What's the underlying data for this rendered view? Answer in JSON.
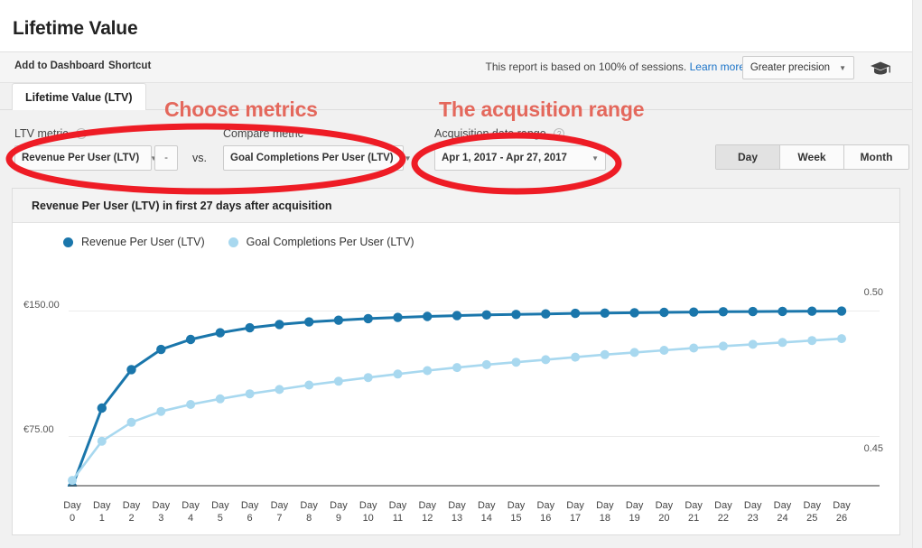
{
  "header": {
    "title": "Lifetime Value",
    "actions": [
      {
        "label": "Add to Dashboard"
      },
      {
        "label": "Shortcut"
      }
    ],
    "sampling_text": "This report is based on 100% of sessions.",
    "sampling_link": "Learn more",
    "precision_value": "Greater precision",
    "gradcap_icon": "graduation-cap-icon"
  },
  "tabs": [
    {
      "label": "Lifetime Value (LTV)",
      "active": true
    }
  ],
  "controls": {
    "ltv_metric_label": "LTV metric",
    "ltv_metric_value": "Revenue Per User (LTV)",
    "dash_value": "-",
    "vs_label": "vs.",
    "compare_metric_label": "Compare metric",
    "compare_metric_value": "Goal Completions Per User (LTV)",
    "acquisition_label": "Acquisition date range",
    "acquisition_value": "Apr 1, 2017  -  Apr 27, 2017",
    "granularity": [
      {
        "label": "Day",
        "active": true
      },
      {
        "label": "Week",
        "active": false
      },
      {
        "label": "Month",
        "active": false
      }
    ]
  },
  "annotations": [
    {
      "text": "Choose metrics"
    },
    {
      "text": "The acqusition range"
    }
  ],
  "panel": {
    "title": "Revenue Per User (LTV) in first 27 days after acquisition"
  },
  "colors": {
    "series_primary": "#1a76ab",
    "series_secondary": "#a8d8ef",
    "annotation": "#e4685c",
    "link": "#1a73c8"
  },
  "chart_data": {
    "type": "line",
    "title": "Revenue Per User (LTV) in first 27 days after acquisition",
    "xlabel": "",
    "ylabel": "",
    "grid": true,
    "legend_position": "top-left",
    "categories": [
      "Day 0",
      "Day 1",
      "Day 2",
      "Day 3",
      "Day 4",
      "Day 5",
      "Day 6",
      "Day 7",
      "Day 8",
      "Day 9",
      "Day 10",
      "Day 11",
      "Day 12",
      "Day 13",
      "Day 14",
      "Day 15",
      "Day 16",
      "Day 17",
      "Day 18",
      "Day 19",
      "Day 20",
      "Day 21",
      "Day 22",
      "Day 23",
      "Day 24",
      "Day 25",
      "Day 26"
    ],
    "axes": {
      "left": {
        "ticks": [
          "€75.00",
          "€150.00"
        ],
        "tick_values": [
          75,
          150
        ],
        "range": [
          45,
          180
        ]
      },
      "right": {
        "ticks": [
          "0.45",
          "0.50"
        ],
        "tick_values": [
          0.45,
          0.5
        ],
        "range": [
          0.44,
          0.512
        ]
      }
    },
    "series": [
      {
        "name": "Revenue Per User (LTV)",
        "color": "#1a76ab",
        "axis": "left",
        "values": [
          45.0,
          92.0,
          115.0,
          127.0,
          133.0,
          137.0,
          140.0,
          142.0,
          143.5,
          144.5,
          145.5,
          146.2,
          146.8,
          147.3,
          147.7,
          148.0,
          148.3,
          148.6,
          148.8,
          149.0,
          149.2,
          149.4,
          149.6,
          149.7,
          149.8,
          149.9,
          150.0
        ]
      },
      {
        "name": "Goal Completions Per User (LTV)",
        "color": "#a8d8ef",
        "axis": "right",
        "values": [
          0.442,
          0.4545,
          0.4605,
          0.464,
          0.4662,
          0.468,
          0.4696,
          0.471,
          0.4724,
          0.4736,
          0.4748,
          0.4759,
          0.477,
          0.478,
          0.4789,
          0.4797,
          0.4805,
          0.4813,
          0.4821,
          0.4828,
          0.4835,
          0.4842,
          0.4848,
          0.4854,
          0.486,
          0.4866,
          0.4872
        ]
      }
    ]
  }
}
